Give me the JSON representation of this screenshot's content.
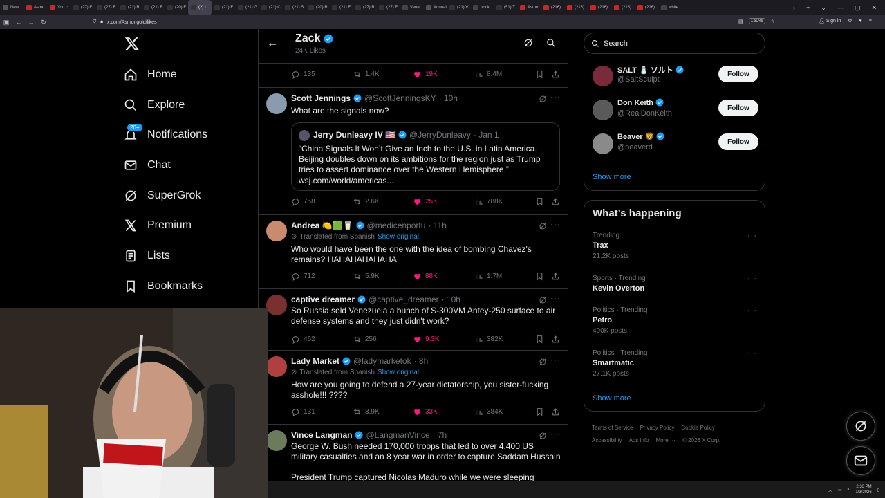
{
  "browser": {
    "tabs": [
      {
        "label": "New"
      },
      {
        "label": "Asmo"
      },
      {
        "label": "You c"
      },
      {
        "label": "(27) F"
      },
      {
        "label": "(27) R"
      },
      {
        "label": "(21) R"
      },
      {
        "label": "(21) R"
      },
      {
        "label": "(20) F"
      },
      {
        "label": "(2) I",
        "active": true
      },
      {
        "label": "(21) F"
      },
      {
        "label": "(21) G"
      },
      {
        "label": "(21) C"
      },
      {
        "label": "(21) S"
      },
      {
        "label": "(20) R"
      },
      {
        "label": "(21) F"
      },
      {
        "label": "(27) R"
      },
      {
        "label": "(27) F"
      },
      {
        "label": "Vene"
      },
      {
        "label": "Annual-1"
      },
      {
        "label": "(21) V"
      },
      {
        "label": "honk"
      },
      {
        "label": "(51) T"
      },
      {
        "label": "Asmo"
      },
      {
        "label": "(216)"
      },
      {
        "label": "(216)"
      },
      {
        "label": "(216)"
      },
      {
        "label": "(216)"
      },
      {
        "label": "(216)"
      },
      {
        "label": "white"
      }
    ],
    "url": "x.com/Asmongold/likes",
    "zoom": "150%",
    "sign_in": "Sign in"
  },
  "nav": {
    "items": [
      {
        "label": "Home"
      },
      {
        "label": "Explore"
      },
      {
        "label": "Notifications",
        "badge": "20+"
      },
      {
        "label": "Chat"
      },
      {
        "label": "SuperGrok"
      },
      {
        "label": "Premium"
      },
      {
        "label": "Lists"
      },
      {
        "label": "Bookmarks"
      }
    ]
  },
  "profile": {
    "name": "Zack",
    "likes": "24K Likes"
  },
  "top_actions": {
    "replies": "135",
    "reposts": "1.4K",
    "likes": "19K",
    "views": "8.4M"
  },
  "posts": [
    {
      "name": "Scott Jennings",
      "handle": "@ScottJenningsKY",
      "time": "· 10h",
      "text": "What are the signals now?",
      "quote": {
        "name": "Jerry Dunleavy IV 🇺🇸",
        "handle": "@JerryDunleavy",
        "time": "· Jan 1",
        "text": "“China Signals It Won’t Give an Inch to the U.S. in Latin America. Beijing doubles down on its ambitions for the region just as Trump tries to assert dominance over the Western Hemisphere.”",
        "link": "wsj.com/world/americas..."
      },
      "replies": "758",
      "reposts": "2.6K",
      "likes": "25K",
      "views": "788K"
    },
    {
      "name": "Andrea 🍋🟩🥛",
      "handle": "@medicenportu",
      "time": "· 11h",
      "translated": "Translated from Spanish",
      "show_original": "Show original",
      "text": "Who would have been the one with the idea of bombing Chavez's remains? HAHAHAHAHAHA",
      "replies": "712",
      "reposts": "5.9K",
      "likes": "88K",
      "views": "1.7M"
    },
    {
      "name": "captive dreamer",
      "handle": "@captive_dreamer",
      "time": "· 10h",
      "text": "So Russia sold Venezuela a bunch of S-300VM Antey-250 surface to air defense systems and they just didn't work?",
      "replies": "462",
      "reposts": "256",
      "likes": "9.3K",
      "views": "382K"
    },
    {
      "name": "Lady Market",
      "handle": "@ladymarketok",
      "time": "· 8h",
      "translated": "Translated from Spanish",
      "show_original": "Show original",
      "text": "How are you going to defend a 27-year dictatorship, you sister-fucking asshole!!! ????",
      "replies": "131",
      "reposts": "3.9K",
      "likes": "33K",
      "views": "384K"
    },
    {
      "name": "Vince Langman",
      "handle": "@LangmanVince",
      "time": "· 7h",
      "text": "George W. Bush needed 170,000 troops that led to over 4,400 US military casualties and an 8 year war in order to capture Saddam Hussain",
      "text2": "President Trump captured Nicolas Maduro while we were sleeping"
    }
  ],
  "search": {
    "placeholder": "Search"
  },
  "who_to_follow": {
    "accounts": [
      {
        "name": "SALT 🧂 ソルト",
        "handle": "@SaltSculpt",
        "button": "Follow"
      },
      {
        "name": "Don Keith",
        "handle": "@RealDonKeith",
        "button": "Follow"
      },
      {
        "name": "Beaver 🦁",
        "handle": "@beaverd",
        "button": "Follow"
      }
    ],
    "show_more": "Show more"
  },
  "happening": {
    "title": "What’s happening",
    "trends": [
      {
        "meta": "Trending",
        "title": "Trax",
        "count": "21.2K posts"
      },
      {
        "meta": "Sports · Trending",
        "title": "Kevin Overton",
        "count": ""
      },
      {
        "meta": "Politics · Trending",
        "title": "Petro",
        "count": "400K posts"
      },
      {
        "meta": "Politics · Trending",
        "title": "Smartmatic",
        "count": "27.1K posts"
      }
    ],
    "show_more": "Show more"
  },
  "footer": {
    "links": [
      "Terms of Service",
      "Privacy Policy",
      "Cookie Policy",
      "Accessibility",
      "Ads info",
      "More ···",
      "© 2026 X Corp."
    ]
  },
  "taskbar": {
    "time": "2:33 PM",
    "date": "1/3/2026"
  },
  "colors": {
    "accent": "#1d9bf0",
    "like": "#f91880",
    "muted": "#71767b"
  }
}
